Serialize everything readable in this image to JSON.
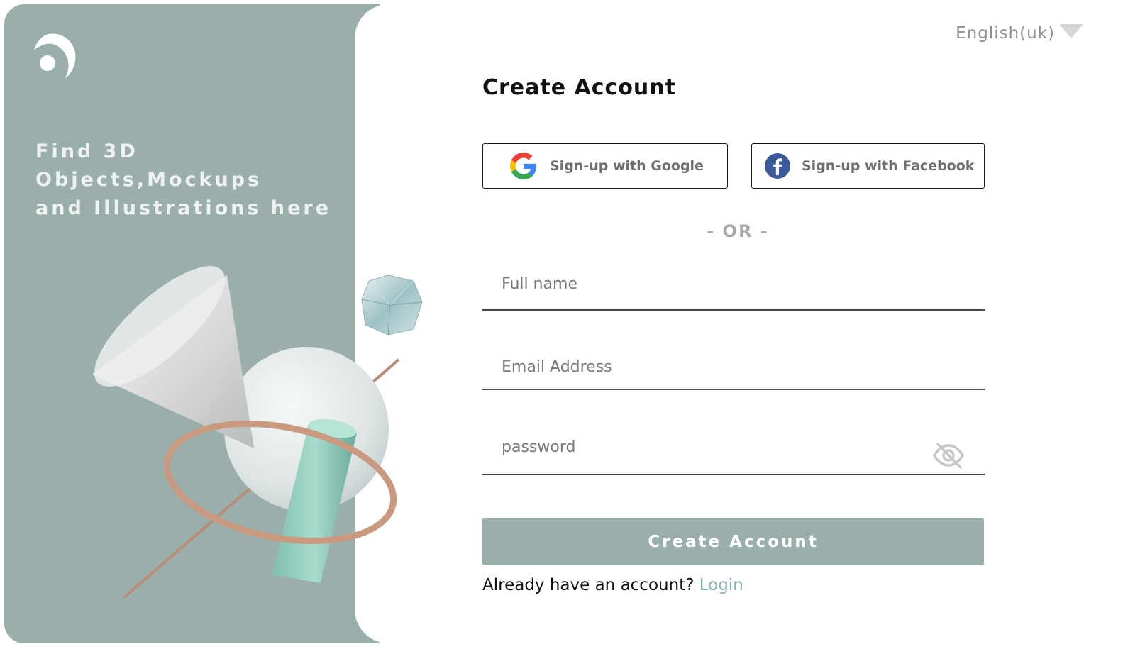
{
  "language": {
    "selected": "English(uk)"
  },
  "hero": {
    "tagline_line1": "Find 3D Objects,Mockups",
    "tagline_line2": "and Illustrations here"
  },
  "form": {
    "title": "Create Account",
    "google_label": "Sign-up with Google",
    "facebook_label": "Sign-up with Facebook",
    "or_text": "- OR -",
    "full_name_placeholder": "Full name",
    "email_placeholder": "Email Address",
    "password_placeholder": "password",
    "submit_label": "Create Account",
    "login_prompt": "Already have an account?",
    "login_link": "Login"
  },
  "colors": {
    "panel": "#9aafab",
    "accent_link": "#86b3b0",
    "text_dark": "#111111"
  },
  "icons": [
    "logo-icon",
    "caret-down-icon",
    "google-icon",
    "facebook-icon",
    "eye-off-icon"
  ]
}
